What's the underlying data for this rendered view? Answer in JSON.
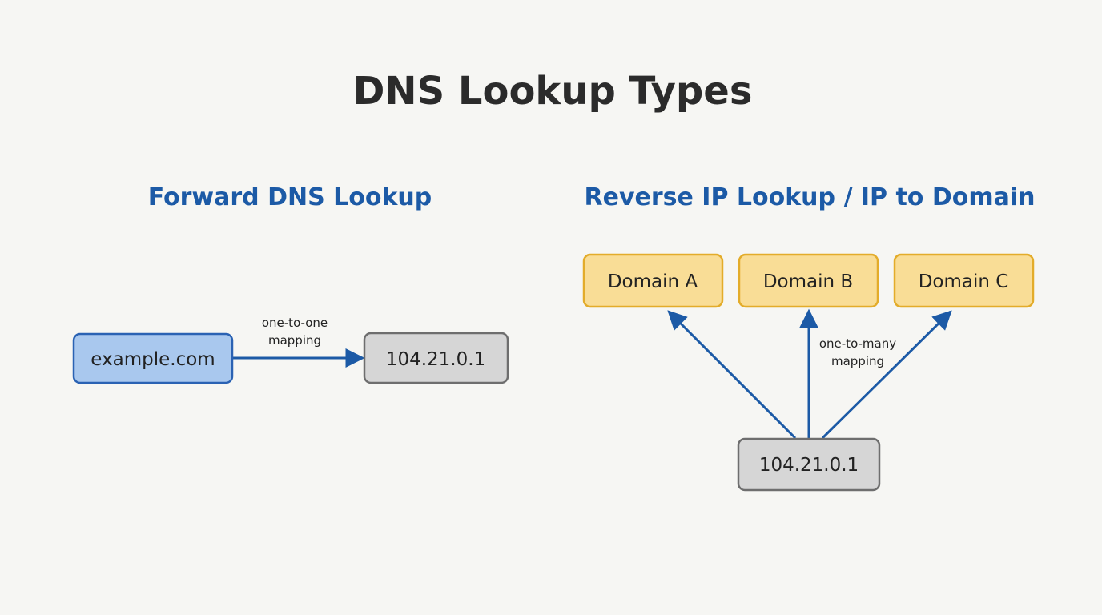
{
  "title": "DNS Lookup Types",
  "forward": {
    "heading": "Forward DNS Lookup",
    "source": "example.com",
    "target": "104.21.0.1",
    "edge_label": [
      "one-to-one",
      "mapping"
    ]
  },
  "reverse": {
    "heading": "Reverse IP Lookup / IP to Domain",
    "source": "104.21.0.1",
    "targets": [
      "Domain A",
      "Domain B",
      "Domain C"
    ],
    "edge_label": [
      "one-to-many",
      "mapping"
    ]
  },
  "colors": {
    "background": "#f6f6f3",
    "title": "#2b2b2b",
    "heading": "#1c5aa6",
    "arrow": "#1c5aa6",
    "domain_node_fill": "#a9c8ee",
    "domain_node_border": "#2a62b3",
    "ip_node_fill": "#d6d6d6",
    "ip_node_border": "#6e6e6e",
    "target_node_fill": "#f9dd96",
    "target_node_border": "#e3ac2a"
  }
}
